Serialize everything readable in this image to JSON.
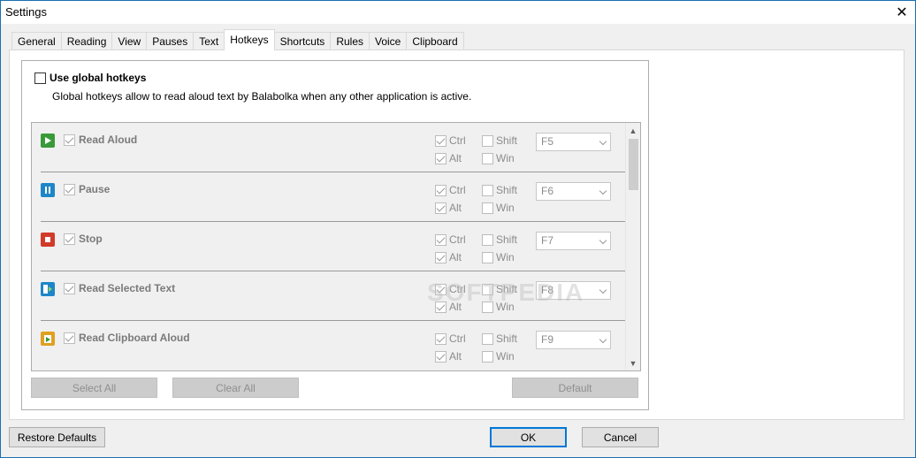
{
  "window": {
    "title": "Settings"
  },
  "tabs": [
    {
      "label": "General"
    },
    {
      "label": "Reading"
    },
    {
      "label": "View"
    },
    {
      "label": "Pauses"
    },
    {
      "label": "Text"
    },
    {
      "label": "Hotkeys",
      "active": true
    },
    {
      "label": "Shortcuts"
    },
    {
      "label": "Rules"
    },
    {
      "label": "Voice"
    },
    {
      "label": "Clipboard"
    }
  ],
  "hotkeys": {
    "use_global_label": "Use global hotkeys",
    "use_global_checked": false,
    "description": "Global hotkeys allow to read aloud text by Balabolka when any other application is active.",
    "rows": [
      {
        "label": "Read Aloud",
        "icon": "play-icon",
        "color": "#3a9a3a",
        "enabled": true,
        "ctrl": true,
        "alt": true,
        "shift": false,
        "win": false,
        "ctrl_label": "Ctrl",
        "alt_label": "Alt",
        "shift_label": "Shift",
        "win_label": "Win",
        "key": "F5"
      },
      {
        "label": "Pause",
        "icon": "pause-icon",
        "color": "#1e86c8",
        "enabled": true,
        "ctrl": true,
        "alt": true,
        "shift": false,
        "win": false,
        "ctrl_label": "Ctrl",
        "alt_label": "Alt",
        "shift_label": "Shift",
        "win_label": "Win",
        "key": "F6"
      },
      {
        "label": "Stop",
        "icon": "stop-icon",
        "color": "#d23a2a",
        "enabled": true,
        "ctrl": true,
        "alt": true,
        "shift": false,
        "win": false,
        "ctrl_label": "Ctrl",
        "alt_label": "Alt",
        "shift_label": "Shift",
        "win_label": "Win",
        "key": "F7"
      },
      {
        "label": "Read Selected Text",
        "icon": "read-selected-icon",
        "color": "#1e86c8",
        "enabled": true,
        "ctrl": true,
        "alt": true,
        "shift": false,
        "win": false,
        "ctrl_label": "Ctrl",
        "alt_label": "Alt",
        "shift_label": "Shift",
        "win_label": "Win",
        "key": "F8"
      },
      {
        "label": "Read Clipboard Aloud",
        "icon": "clipboard-icon",
        "color": "#e0a020",
        "enabled": true,
        "ctrl": true,
        "alt": true,
        "shift": false,
        "win": false,
        "ctrl_label": "Ctrl",
        "alt_label": "Alt",
        "shift_label": "Shift",
        "win_label": "Win",
        "key": "F9"
      }
    ],
    "select_all": "Select All",
    "clear_all": "Clear All",
    "default": "Default"
  },
  "footer": {
    "restore_defaults": "Restore Defaults",
    "ok": "OK",
    "cancel": "Cancel"
  },
  "watermark": "SOFTPEDIA"
}
